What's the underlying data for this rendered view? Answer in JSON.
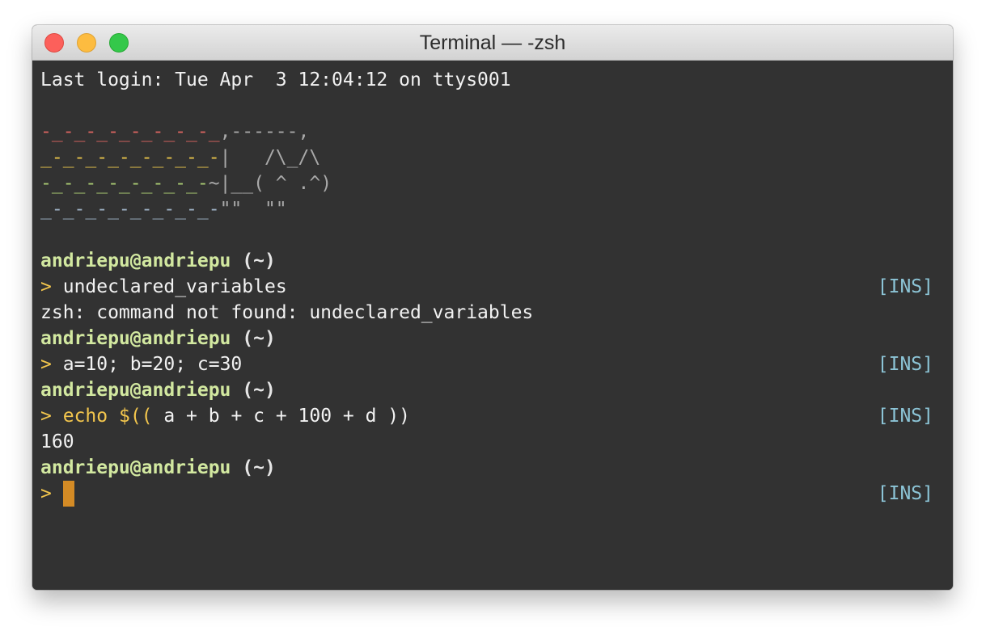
{
  "window": {
    "title": "Terminal — -zsh"
  },
  "terminal": {
    "last_login": "Last login: Tue Apr  3 12:04:12 on ttys001",
    "art": [
      {
        "trail": "-_-_-_-_-_-_-_-_",
        "tail": ",------,"
      },
      {
        "trail": "_-_-_-_-_-_-_-_-",
        "tail": "|   /\\_/\\"
      },
      {
        "trail": "-_-_-_-_-_-_-_-",
        "tail": "~|__( ^ .^)"
      },
      {
        "trail": "_-_-_-_-_-_-_-_-",
        "tail": "\"\"  \"\""
      }
    ],
    "user_host": "andriepu@andriepu",
    "dir": "(~)",
    "caret": ">",
    "mode": "[INS]",
    "cmd1": "undeclared_variables",
    "err1": "zsh: command not found: undeclared_variables",
    "cmd2": "a=10; b=20; c=30",
    "cmd3_keyword": "echo",
    "cmd3_dollar": "$((",
    "cmd3_rest": " a + b + c + 100 + d ))",
    "out3": "160"
  },
  "colors": {
    "background": "#323232",
    "prompt_user": "#d2e8a0",
    "caret": "#f3c64d",
    "mode_indicator": "#8cc4d6",
    "cursor": "#d48b25"
  }
}
